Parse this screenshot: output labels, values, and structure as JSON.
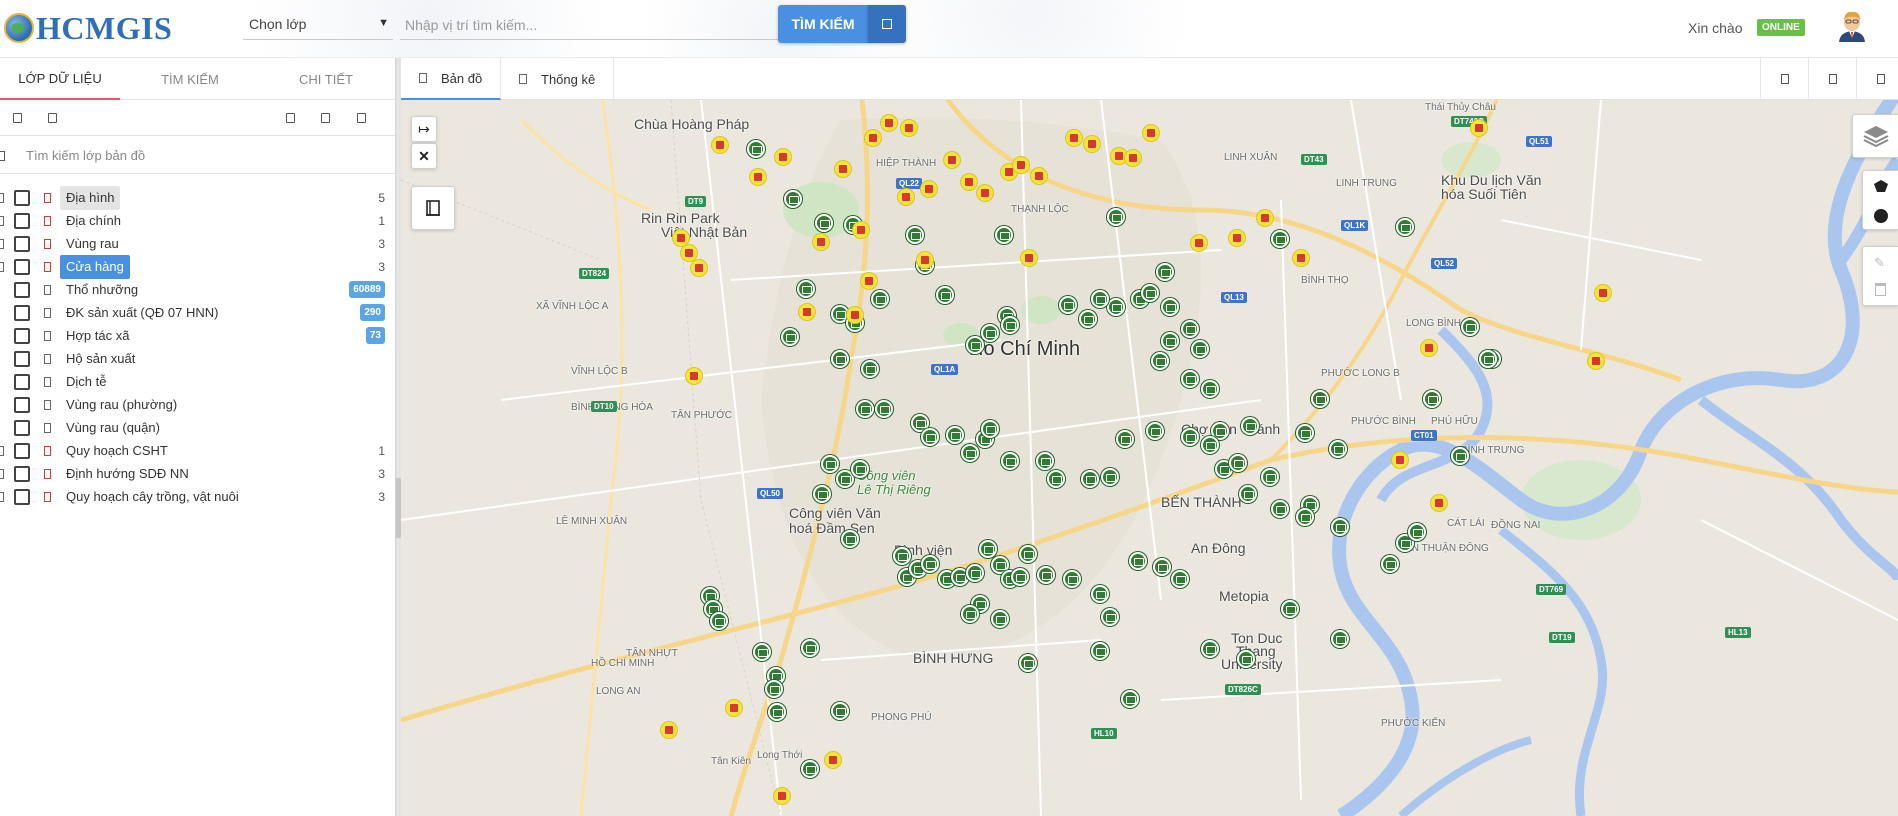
{
  "header": {
    "logo_text": "HCMGIS",
    "layer_select": "Chọn lớp",
    "search_placeholder": "Nhập vị trí tìm kiếm...",
    "search_button": "TÌM KIẾM",
    "greeting": "Xin chào",
    "status": "ONLINE",
    "accent_color": "#4a90e2",
    "status_color": "#6abf47"
  },
  "left_tabs": [
    {
      "label": "LỚP DỮ LIỆU",
      "active": true
    },
    {
      "label": "TÌM KIẾM",
      "active": false
    },
    {
      "label": "CHI TIẾT",
      "active": false
    }
  ],
  "layer_search_placeholder": "Tìm kiếm lớp bản đồ",
  "layers": [
    {
      "label": "Địa hình",
      "count": "5",
      "state": "hover",
      "group": true
    },
    {
      "label": "Địa chính",
      "count": "1",
      "state": "",
      "group": true
    },
    {
      "label": "Vùng rau",
      "count": "3",
      "state": "",
      "group": true
    },
    {
      "label": "Cửa hàng",
      "count": "3",
      "state": "selected",
      "group": true
    },
    {
      "label": "Thổ nhưỡng",
      "badge": "60889",
      "state": "",
      "group": false
    },
    {
      "label": "ĐK sản xuất (QĐ 07 HNN)",
      "badge": "290",
      "state": "",
      "group": false
    },
    {
      "label": "Hợp tác xã",
      "badge": "73",
      "state": "",
      "group": false
    },
    {
      "label": "Hộ sản xuất",
      "state": "",
      "group": false
    },
    {
      "label": "Dịch tễ",
      "state": "",
      "group": false
    },
    {
      "label": "Vùng rau (phường)",
      "state": "",
      "group": false
    },
    {
      "label": "Vùng rau (quận)",
      "state": "",
      "group": false
    },
    {
      "label": "Quy hoạch CSHT",
      "count": "1",
      "state": "",
      "group": true
    },
    {
      "label": "Định hướng SDĐ NN",
      "count": "3",
      "state": "",
      "group": true
    },
    {
      "label": "Quy hoạch cây trồng, vật nuôi",
      "count": "3",
      "state": "",
      "group": true
    }
  ],
  "map_tabs": [
    {
      "label": "Bản đồ",
      "active": true
    },
    {
      "label": "Thống kê",
      "active": false
    }
  ],
  "map": {
    "city": "Hồ Chí Minh",
    "labels": [
      "Chùa Hoàng Pháp",
      "Rin Rin Park",
      "Việt Nhật Bản",
      "XÃ VĨNH LỘC A",
      "VĨNH LỘC B",
      "BÌNH HƯNG HÒA",
      "TÂN PHƯỚC",
      "Công viên",
      "Lê Thị Riêng",
      "Công viên Văn",
      "hoá Đầm Sen",
      "Bình viện",
      "BÌNH HƯNG",
      "PHONG PHÚ",
      "LÊ MINH XUÂN",
      "TÂN NHỰT",
      "HỒ CHÍ MINH",
      "LONG AN",
      "HIỆP THÀNH",
      "THẠNH LỘC",
      "LINH XUÂN",
      "LINH TRUNG",
      "BÌNH THỌ",
      "PHƯỚC LONG B",
      "Khu Du lịch Văn",
      "hóa Suối Tiên",
      "LONG BÌNH",
      "PHƯỚC BÌNH",
      "PHÚ HỮU",
      "BÌNH TRƯNG",
      "CÁT LÁI",
      "ĐỒNG NAI",
      "Ton Duc",
      "Thang",
      "University",
      "Metopia",
      "An Đông",
      "BẾN THÀNH",
      "Chợ Văn Thánh",
      "TÂN THUẬN ĐÔNG",
      "PHƯỚC KIỂN",
      "Thái Thủy Châu",
      "Tân Kiên",
      "Long Thới"
    ],
    "road_signs": [
      "QL1A",
      "QL13",
      "QL22",
      "DT9",
      "DT824",
      "DT10",
      "QL50",
      "HL10",
      "CT01",
      "DT769",
      "HL13",
      "DT19",
      "QL52",
      "QL1K",
      "DT743C",
      "DT43",
      "QL51",
      "DT826C"
    ]
  },
  "icons": {
    "green_marker": "store-marker",
    "yellow_marker": "shop-marker",
    "layers_control": "layers-icon",
    "polygon_tool": "polygon-icon",
    "circle_tool": "circle-icon"
  }
}
